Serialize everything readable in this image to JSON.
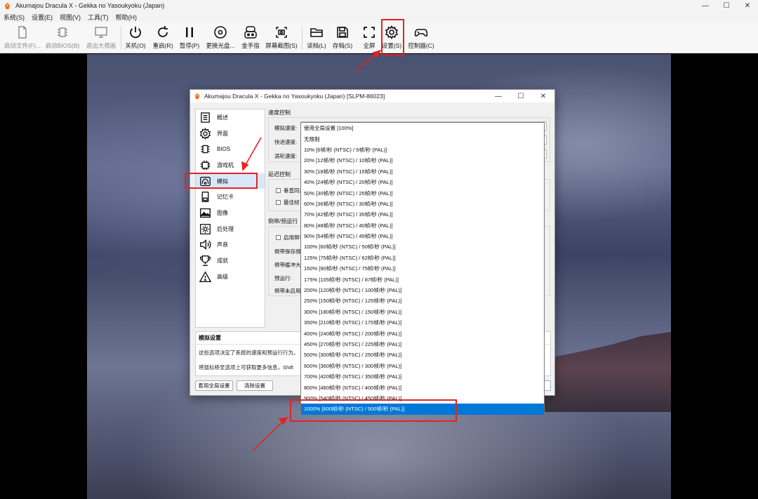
{
  "window": {
    "title": "Akumajou Dracula X - Gekka no Yasoukyoku (Japan)",
    "controls": [
      "—",
      "☐",
      "✕"
    ]
  },
  "menubar": [
    "系统(S)",
    "设置(E)",
    "视图(V)",
    "工具(T)",
    "帮助(H)"
  ],
  "toolbar": [
    {
      "label": "启动文件(F)...",
      "icon": "file-icon",
      "enabled": false
    },
    {
      "label": "启动BIOS(B)",
      "icon": "chip-icon",
      "enabled": false
    },
    {
      "label": "退出大视画",
      "icon": "monitor-icon",
      "enabled": false
    },
    {
      "label": "关机(O)",
      "icon": "power-icon",
      "enabled": true
    },
    {
      "label": "重启(R)",
      "icon": "restart-icon",
      "enabled": true
    },
    {
      "label": "暂停(P)",
      "icon": "pause-icon",
      "enabled": true
    },
    {
      "label": "更换光盘...",
      "icon": "disc-icon",
      "enabled": true
    },
    {
      "label": "金手指",
      "icon": "gamepad-cheat-icon",
      "enabled": true
    },
    {
      "label": "屏幕截图(S)",
      "icon": "screenshot-icon",
      "enabled": true
    },
    {
      "label": "读档(L)",
      "icon": "folder-open-icon",
      "enabled": true
    },
    {
      "label": "存档(S)",
      "icon": "save-icon",
      "enabled": true
    },
    {
      "label": "全屏",
      "icon": "fullscreen-icon",
      "enabled": true
    },
    {
      "label": "设置(S)",
      "icon": "gear-icon",
      "enabled": true
    },
    {
      "label": "控制器(C)",
      "icon": "controller-icon",
      "enabled": true
    }
  ],
  "dialog": {
    "title": "Akumajou Dracula X - Gekka no Yasoukyoku (Japan) [SLPM-86023]",
    "sidebar": [
      {
        "label": "概述",
        "icon": "list-icon"
      },
      {
        "label": "界面",
        "icon": "gear-icon"
      },
      {
        "label": "BIOS",
        "icon": "chip-icon"
      },
      {
        "label": "游戏机",
        "icon": "cpu-icon"
      },
      {
        "label": "模拟",
        "icon": "emulation-icon",
        "active": true
      },
      {
        "label": "记忆卡",
        "icon": "memory-card-icon"
      },
      {
        "label": "图像",
        "icon": "image-icon"
      },
      {
        "label": "后处理",
        "icon": "sun-icon"
      },
      {
        "label": "声音",
        "icon": "speaker-icon"
      },
      {
        "label": "成就",
        "icon": "trophy-icon"
      },
      {
        "label": "高级",
        "icon": "warning-icon"
      }
    ],
    "speed_group": {
      "title": "速度控制",
      "emulation_speed_label": "模拟速度:",
      "fast_forward_label": "快进速度:",
      "turbo_label": "涡轮速度:"
    },
    "latency_group": {
      "title": "延迟控制",
      "vsync_label": "垂直同步",
      "optimal_label": "最佳帧"
    },
    "rewind_group": {
      "title": "倒带/预运行",
      "enable_label": "启用倒带",
      "save_freq_label": "倒带保存频",
      "buffer_label": "倒带缓冲大",
      "runahead_label": "预运行:",
      "rewind_off_label": "倒带未启用"
    },
    "description": {
      "title": "模拟设置",
      "line1": "这些选项决定了系统的速度和预运行行为。",
      "line2": "将鼠标移至选项上可获取更多信息，Shift"
    },
    "buttons": {
      "use_global": "套用全局设置",
      "clear": "清除设置"
    }
  },
  "dropdown": {
    "options": [
      "使用全局设置 [100%]",
      "无限制",
      "10% [6帧/秒 (NTSC) / 5帧/秒 (PAL)]",
      "20% [12帧/秒 (NTSC) / 10帧/秒 (PAL)]",
      "30% [18帧/秒 (NTSC) / 15帧/秒 (PAL)]",
      "40% [24帧/秒 (NTSC) / 20帧/秒 (PAL)]",
      "50% [30帧/秒 (NTSC) / 25帧/秒 (PAL)]",
      "60% [36帧/秒 (NTSC) / 30帧/秒 (PAL)]",
      "70% [42帧/秒 (NTSC) / 35帧/秒 (PAL)]",
      "80% [48帧/秒 (NTSC) / 40帧/秒 (PAL)]",
      "90% [54帧/秒 (NTSC) / 45帧/秒 (PAL)]",
      "100% [60帧/秒 (NTSC) / 50帧/秒 (PAL)]",
      "125% [75帧/秒 (NTSC) / 62帧/秒 (PAL)]",
      "150% [90帧/秒 (NTSC) / 75帧/秒 (PAL)]",
      "175% [105帧/秒 (NTSC) / 87帧/秒 (PAL)]",
      "200% [120帧/秒 (NTSC) / 100帧/秒 (PAL)]",
      "250% [150帧/秒 (NTSC) / 125帧/秒 (PAL)]",
      "300% [180帧/秒 (NTSC) / 150帧/秒 (PAL)]",
      "350% [210帧/秒 (NTSC) / 175帧/秒 (PAL)]",
      "400% [240帧/秒 (NTSC) / 200帧/秒 (PAL)]",
      "450% [270帧/秒 (NTSC) / 225帧/秒 (PAL)]",
      "500% [300帧/秒 (NTSC) / 250帧/秒 (PAL)]",
      "600% [360帧/秒 (NTSC) / 300帧/秒 (PAL)]",
      "700% [420帧/秒 (NTSC) / 350帧/秒 (PAL)]",
      "800% [480帧/秒 (NTSC) / 400帧/秒 (PAL)]",
      "900% [540帧/秒 (NTSC) / 450帧/秒 (PAL)]",
      "1000% [600帧/秒 (NTSC) / 500帧/秒 (PAL)]"
    ],
    "selected_index": 26
  },
  "colors": {
    "annotation": "#e52222",
    "selection": "#0078d7",
    "sidebar_active": "#d9e8f8"
  }
}
